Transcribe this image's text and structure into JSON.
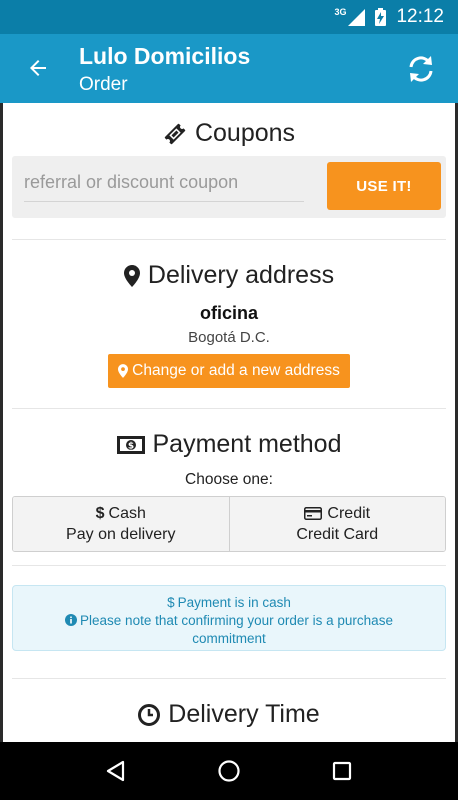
{
  "status_bar": {
    "network": "3G",
    "time": "12:12"
  },
  "app_bar": {
    "title": "Lulo Domicilios",
    "subtitle": "Order"
  },
  "coupons": {
    "title": "Coupons",
    "placeholder": "referral or discount coupon",
    "value": "",
    "button": "USE IT!"
  },
  "delivery": {
    "title": "Delivery address",
    "name": "oficina",
    "city": "Bogotá D.C.",
    "change_button": "Change or add a new address"
  },
  "payment": {
    "title": "Payment method",
    "choose": "Choose one:",
    "options": [
      {
        "label": "Cash",
        "sub": "Pay on delivery",
        "icon": "dollar-icon"
      },
      {
        "label": "Credit",
        "sub": "Credit Card",
        "icon": "credit-card-icon"
      }
    ],
    "info_line1": "Payment is in cash",
    "info_line2": "Please note that confirming your order is a purchase commitment"
  },
  "delivery_time": {
    "title": "Delivery Time"
  },
  "colors": {
    "status": "#0b7ea8",
    "appbar": "#1a98c7",
    "accent": "#f7931e",
    "info": "#1f8ab3"
  }
}
